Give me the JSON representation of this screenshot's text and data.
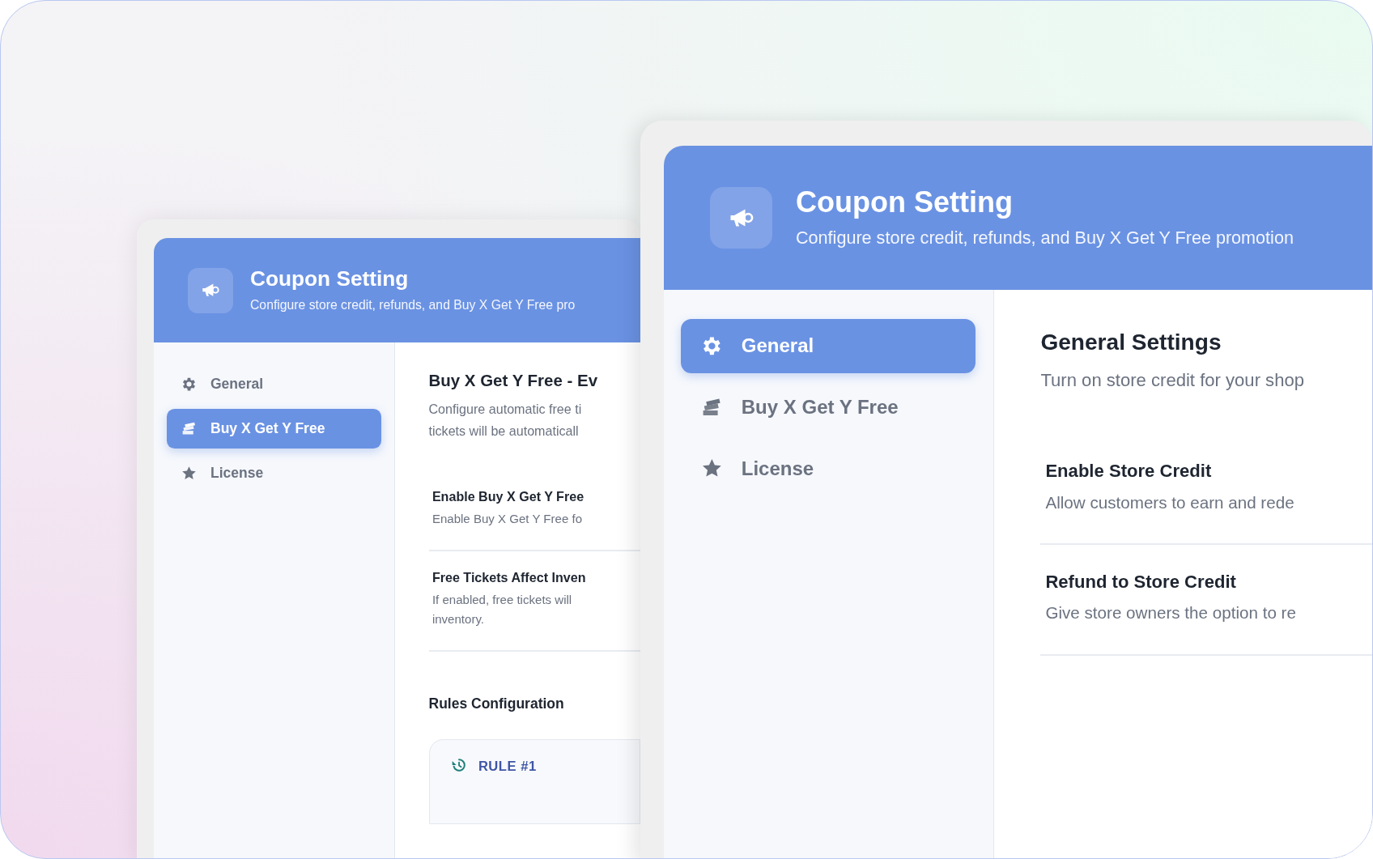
{
  "windows": [
    {
      "title": "Coupon Setting",
      "subtitle": "Configure store credit, refunds, and Buy X Get Y Free pro",
      "nav": [
        {
          "label": "General",
          "selected": false
        },
        {
          "label": "Buy X Get Y Free",
          "selected": true
        },
        {
          "label": "License",
          "selected": false
        }
      ],
      "section": {
        "title": "Buy X Get Y Free - Ev",
        "lines": [
          "Configure automatic free ti",
          "tickets will be automaticall"
        ]
      },
      "settings": [
        {
          "title": "Enable Buy X Get Y Free",
          "lines": [
            "Enable Buy X Get Y Free fo"
          ]
        },
        {
          "title": "Free Tickets Affect Inven",
          "lines": [
            "If enabled, free tickets will",
            "inventory."
          ]
        }
      ],
      "subsection": "Rules Configuration",
      "rules": [
        "RULE #1"
      ]
    },
    {
      "title": "Coupon Setting",
      "subtitle": "Configure store credit, refunds, and Buy X Get Y Free promotion",
      "nav": [
        {
          "label": "General",
          "selected": true
        },
        {
          "label": "Buy X Get Y Free",
          "selected": false
        },
        {
          "label": "License",
          "selected": false
        }
      ],
      "section": {
        "title": "General Settings",
        "lines": [
          "Turn on store credit for your shop"
        ]
      },
      "settings": [
        {
          "title": "Enable Store Credit",
          "lines": [
            "Allow customers to earn and rede"
          ]
        },
        {
          "title": "Refund to Store Credit",
          "lines": [
            "Give store owners the option to re"
          ]
        }
      ]
    }
  ]
}
